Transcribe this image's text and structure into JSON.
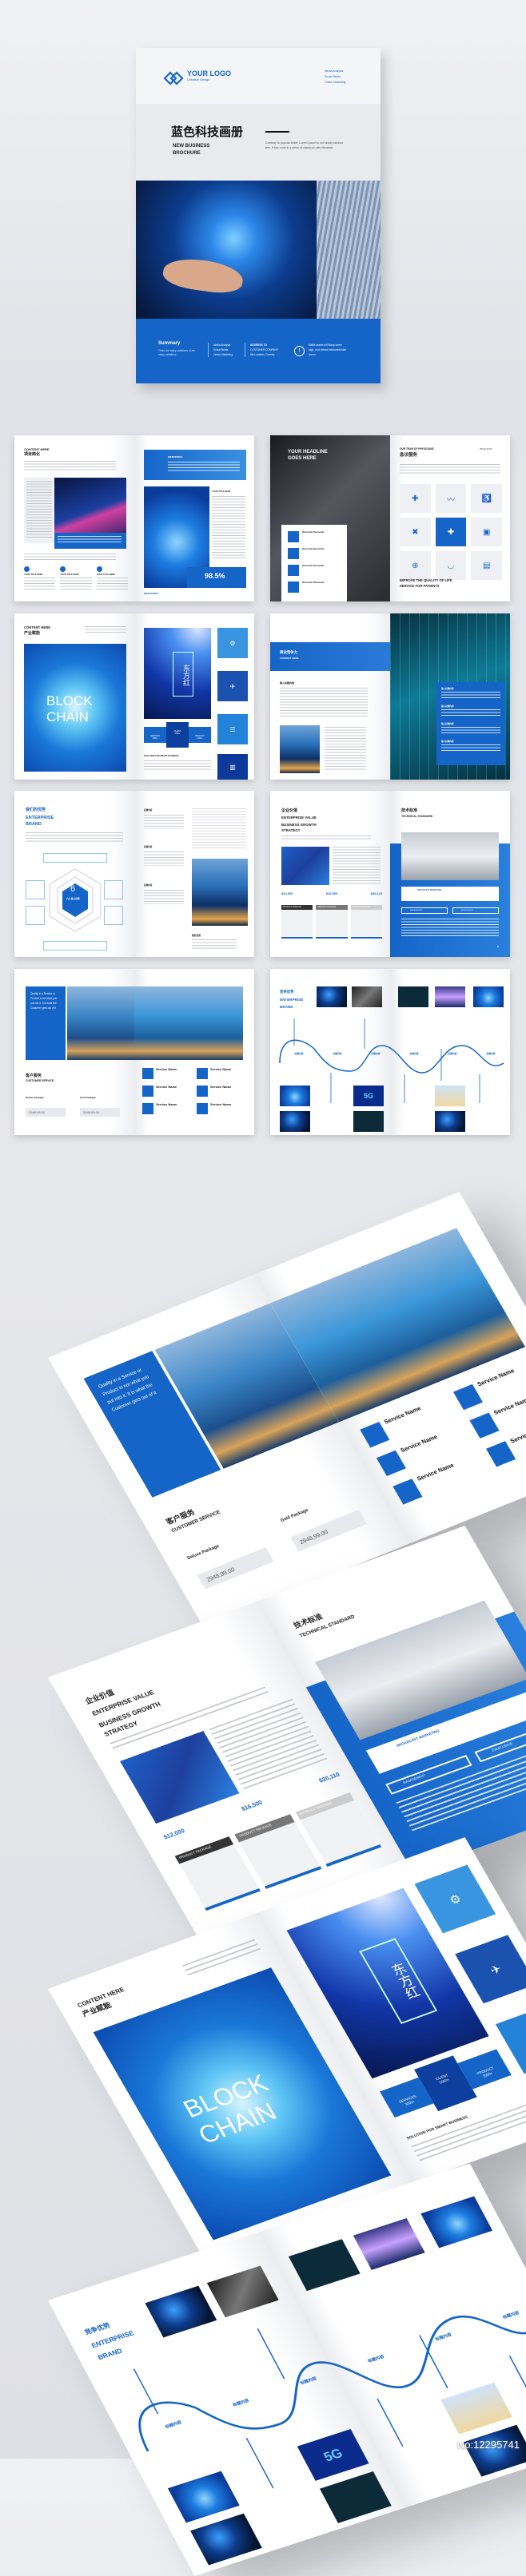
{
  "cover": {
    "logo_text": "YOUR LOGO",
    "logo_sub": "Creative Design",
    "top_links": [
      "Media Analysis",
      "Social Media",
      "Online Marketing"
    ],
    "title_cn": "蓝色科技画册",
    "title_en_1": "NEW BUSINESS",
    "title_en_2": "BROCHURE",
    "intro": "Contrary to popular belief, Lorem Ipsum is not simply random text. It has roots in a piece of classical Latin literature.",
    "footer": {
      "summary_title": "Summary",
      "summary_text": "There are many variations of  are many variations.",
      "col2": [
        "Media Analysis",
        "Social Media",
        "Online Marketing"
      ],
      "col3_title": "ADDRESS TO",
      "col3": [
        "CUSTOMER COMPANY",
        "9th Location, Country"
      ],
      "col4": "Mattis assets mil Bump lorem fugit, ut ut eleved extendrerit blah lpsum."
    }
  },
  "spread1": {
    "heading": "CONTENT HERE",
    "heading_cn": "项目简化",
    "box_title": "BIENVENIDA",
    "side_title": "YOUR TITLE HERE",
    "stat": "98.5%",
    "quote_title": "BIENVENIDA",
    "cols": [
      "YOUR TITLE HERE",
      "YOUR TITLE HERE",
      "YOUR TITLE HERE"
    ]
  },
  "spread2": {
    "headline_1": "YOUR HEADLINE",
    "headline_2": "GOES HERE",
    "items": [
      "Bienvenido Bienvenido",
      "Bienvenido Bienvenido",
      "Bienvenido Bienvenido",
      "Bienvenido Bienvenido"
    ],
    "team": "OUR TEAM OF PHYSICIANS",
    "team_cn": "急诊服务",
    "page": "PAGE 01/02",
    "icons": [
      "✚",
      "〰",
      "♿",
      "✖",
      "✚",
      "▣",
      "⊕",
      "◡",
      "▤"
    ],
    "tag_1": "IMPROVE THE QUALITY OF LIFE",
    "tag_2": "SERVICE FOR PATIENTS"
  },
  "spread3": {
    "heading": "CONTENT HERE",
    "heading_cn": "产业赋能",
    "block_1": "BLOCK",
    "block_2": "CHAIN",
    "east": "东方红",
    "stats": [
      {
        "label": "SERVICES",
        "value": "3000+"
      },
      {
        "label": "CLIENT",
        "value": "5000+"
      },
      {
        "label": "PRODUCT",
        "value": "2000+"
      }
    ],
    "solution": "SOLUTION FOR SMART BUSINESS",
    "icons": [
      "⚙",
      "✈",
      "☰",
      "▥"
    ]
  },
  "spread4": {
    "banner_cn": "商业竞争力",
    "banner_en": "CONTENT HERE",
    "sub": "输入标题内容",
    "panel_items": [
      "输入标题内容",
      "输入标题内容",
      "输入标题内容",
      "输入标题内容"
    ]
  },
  "spread5": {
    "title_cn": "我们的优势",
    "title_1": "ENTERPRISE",
    "title_2": "BRAND",
    "hex_num": "6",
    "hex_label": "六大核心优势",
    "blocks": [
      "标题内容",
      "标题内容",
      "标题内容"
    ],
    "service": "服务优势"
  },
  "spread6": {
    "title_cn": "企业价值",
    "title_1": "ENTERPRISE VALUE",
    "title_2": "BUSINESS GROWTH",
    "title_3": "STRATEGY",
    "prices": [
      "$12,000",
      "$16,500",
      "$20,110"
    ],
    "packages": [
      "PRODUCT PACKAGE",
      "PRODUCT PACKAGE",
      "PRODUCT PACKAGE"
    ],
    "tech_cn": "技术标准",
    "tech_en": "TECHNICAL STANDARD",
    "broadcast": "BROADCAST MARKETING",
    "checks": [
      "MANAGEMENT",
      "EXCELLENCE"
    ],
    "page_no": "8"
  },
  "spread7": {
    "quote": "Quality in a Service or Product is not what you put into it. It is what the Customer gets out of it",
    "title_cn": "客户服务",
    "title_en": "CUSTOMER SERVICE",
    "deluxe": "Deluxe Package",
    "gold": "Gold Package",
    "price_1": "2948,99.00",
    "price_2": "2948,99.00",
    "services": [
      "Service Name",
      "Service Name",
      "Service Name",
      "Service Name",
      "Service Name",
      "Service Name"
    ]
  },
  "spread8": {
    "title_cn": "竞争优势",
    "title_1": "ENTERPRISE",
    "title_2": "BRAND",
    "nodes": [
      "标题内容",
      "标题内容",
      "标题内容",
      "标题内容",
      "标题内容",
      "标题内容"
    ],
    "badge": "5G"
  },
  "watermark": "No:12295741",
  "colors": {
    "accent": "#1565c8",
    "background": "#e4e5e9"
  }
}
